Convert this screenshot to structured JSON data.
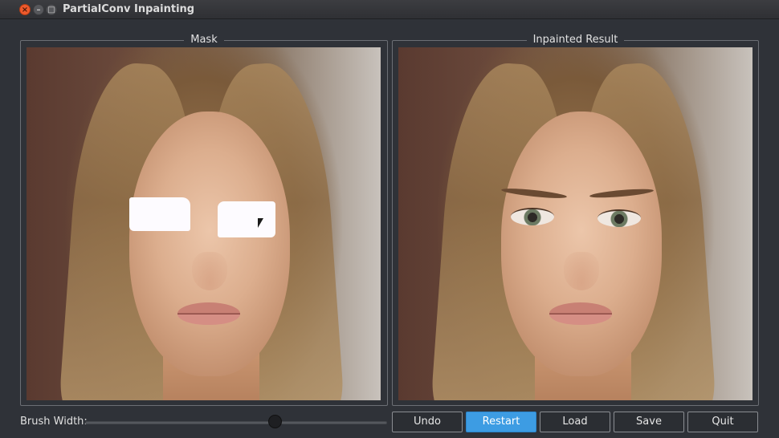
{
  "window": {
    "title": "PartialConv Inpainting",
    "close_glyph": "×",
    "minimize_glyph": "–",
    "maximize_glyph": "□"
  },
  "mask_panel": {
    "title": "Mask"
  },
  "result_panel": {
    "title": "Inpainted Result"
  },
  "controls": {
    "brush_width_label": "Brush Width:",
    "brush_width_value": 0.63,
    "buttons": [
      {
        "label": "Undo",
        "style": "normal"
      },
      {
        "label": "Restart",
        "style": "primary"
      },
      {
        "label": "Load",
        "style": "normal"
      },
      {
        "label": "Save",
        "style": "normal"
      },
      {
        "label": "Quit",
        "style": "normal"
      }
    ]
  },
  "colors": {
    "accent": "#3d9ce3",
    "background": "#2f3238",
    "mask": "#fdfbff"
  }
}
